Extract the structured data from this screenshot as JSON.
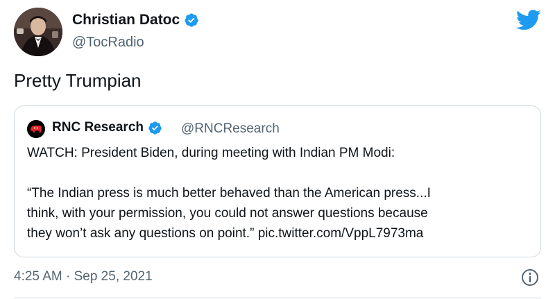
{
  "tweet": {
    "author": {
      "name": "Christian Datoc",
      "handle": "@TocRadio",
      "verified": true,
      "avatar_icon": "profile-photo"
    },
    "text": "Pretty Trumpian",
    "timestamp": "4:25 AM · Sep 25, 2021",
    "brand_icon": "twitter-bird-icon",
    "colors": {
      "brand_blue": "#1d9bf0",
      "text_primary": "#0f1419",
      "text_secondary": "#536471",
      "border": "#cfd9de"
    }
  },
  "quoted": {
    "author": {
      "name": "RNC Research",
      "handle": "@RNCResearch",
      "verified": true,
      "avatar_icon": "rnc-elephant-logo"
    },
    "lines": [
      "WATCH: President Biden, during meeting with Indian PM Modi:",
      "“The Indian press is much better behaved than the American press...I",
      "think, with your permission, you could not answer questions because",
      "they won’t ask any questions on point.” pic.twitter.com/VppL7973ma"
    ]
  }
}
